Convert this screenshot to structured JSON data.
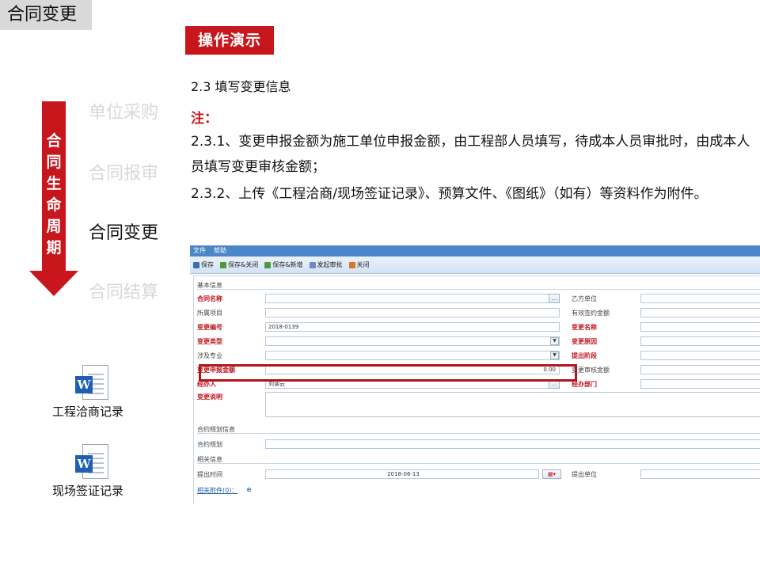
{
  "header": {
    "corner_title": "合同变更",
    "badge": "操作演示"
  },
  "lifecycle": {
    "label": "合同生命周期",
    "stages": [
      {
        "label": "单位采购",
        "active": false
      },
      {
        "label": "合同报审",
        "active": false
      },
      {
        "label": "合同变更",
        "active": true
      },
      {
        "label": "合同结算",
        "active": false
      }
    ]
  },
  "files": [
    {
      "label": "工程洽商记录",
      "icon": "word-doc-icon"
    },
    {
      "label": "现场签证记录",
      "icon": "word-doc-icon"
    }
  ],
  "content": {
    "step_title": "2.3 填写变更信息",
    "note_label": "注：",
    "paragraphs": [
      "2.3.1、变更申报金额为施工单位申报金额，由工程部人员填写，待成本人员审批时，由成本人员填写变更审核金额；",
      "2.3.2、上传《工程洽商/现场签证记录》、预算文件、《图纸》（如有）等资料作为附件。"
    ]
  },
  "app": {
    "menu": [
      "文件",
      "帮助"
    ],
    "toolbar": [
      "保存",
      "保存&关闭",
      "保存&新增",
      "发起审批",
      "关闭"
    ],
    "sections": {
      "basic": "基本信息",
      "plan": "合约规划信息",
      "related": "相关信息"
    },
    "fields": {
      "contract_name": "合同名称",
      "project": "所属项目",
      "change_no": "变更编号",
      "change_no_value": "2018-0139",
      "change_type": "变更类型",
      "discipline": "涉及专业",
      "declared_amount": "变更申报金额",
      "declared_amount_value": "0.00",
      "handler": "经办人",
      "handler_value": "刘读云",
      "description": "变更说明",
      "party_b": "乙方单位",
      "valid_amount": "有效签约金额",
      "change_name": "变更名称",
      "change_reason": "变更原因",
      "proposal_stage": "提出阶段",
      "audit_amount": "变更审核金额",
      "handler_dept": "经办部门",
      "plan": "合约规划",
      "submit_time": "提出时间",
      "submit_time_value": "2018-06-13",
      "submit_unit": "提出单位",
      "attachments": "相关附件(0)："
    }
  },
  "colors": {
    "accent_red": "#c8161d",
    "app_blue": "#4a86c8"
  }
}
